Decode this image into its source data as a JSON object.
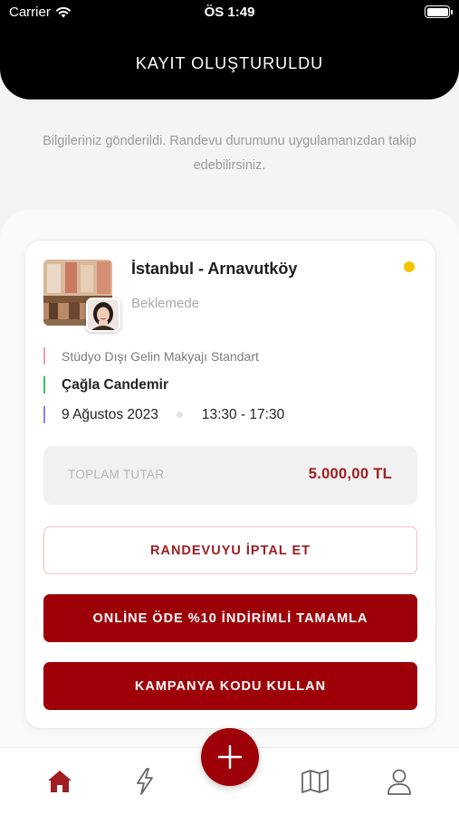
{
  "status_bar": {
    "carrier": "Carrier",
    "time": "ÖS 1:49",
    "wifi_icon": "wifi-icon",
    "battery_icon": "battery-icon"
  },
  "header": {
    "title": "KAYIT OLUŞTURULDU"
  },
  "info": {
    "message": "Bilgileriniz gönderildi. Randevu durumunu uygulamanızdan takip edebilirsiniz."
  },
  "appointment": {
    "location": "İstanbul - Arnavutköy",
    "status": "Beklemede",
    "status_color": "#f5c400",
    "service": "Stüdyo Dışı Gelin Makyajı Standart",
    "artist": "Çağla Candemir",
    "date": "9 Ağustos 2023",
    "time_range": "13:30 - 17:30",
    "accent_colors": {
      "service": "#f2a0a7",
      "artist": "#3fbf52",
      "date": "#8b83e6"
    }
  },
  "total": {
    "label": "TOPLAM TUTAR",
    "value": "5.000,00 TL"
  },
  "actions": {
    "cancel_label": "RANDEVUYU İPTAL ET",
    "online_pay_label": "ONLİNE ÖDE %10 İNDİRİMLİ TAMAMLA",
    "campaign_label": "KAMPANYA KODU KULLAN"
  },
  "tabbar": {
    "items": [
      {
        "icon": "home-icon",
        "active": true
      },
      {
        "icon": "lightning-icon",
        "active": false
      },
      {
        "icon": "plus-icon",
        "active": false
      },
      {
        "icon": "map-icon",
        "active": false
      },
      {
        "icon": "user-icon",
        "active": false
      }
    ]
  },
  "colors": {
    "brand": "#9e0008",
    "header_bg": "#000000",
    "total_value": "#9e1e22"
  }
}
